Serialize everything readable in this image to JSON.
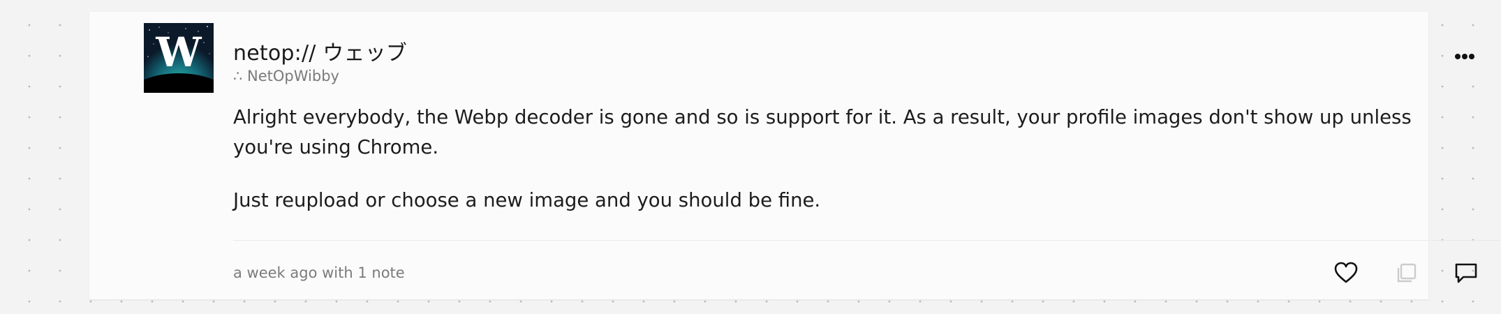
{
  "post": {
    "author": {
      "name": "netop:// ウェッブ",
      "handle": "∴ NetOpWibby",
      "avatar_letter": "W"
    },
    "body": [
      "Alright everybody, the Webp decoder is gone and so is support for it. As a result, your profile images don't show up unless you're using Chrome.",
      "Just reupload or choose a new image and you should be fine."
    ],
    "meta": "a week ago with 1 note",
    "actions": {
      "more_icon": "more-horizontal-icon",
      "like_icon": "heart-icon",
      "reblog_icon": "reblog-icon",
      "reply_icon": "comment-icon"
    }
  },
  "colors": {
    "background": "#f3f3f3",
    "card": "#fbfbfb",
    "text": "#1c1c1c",
    "muted": "#7b7b7b",
    "disabled": "#cccccc"
  }
}
